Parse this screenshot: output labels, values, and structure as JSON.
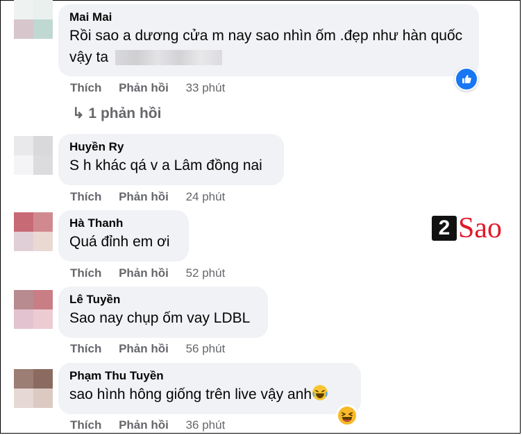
{
  "actions": {
    "like": "Thích",
    "reply": "Phản hồi"
  },
  "comments": [
    {
      "name": "Mai Mai",
      "text": "Rồi sao a dương cửa m nay sao nhìn ốm .đẹp như hàn quốc vậy ta",
      "time": "33 phút",
      "reaction": "like-icon"
    },
    {
      "name": "Huyền Ry",
      "text": "S h khác qá v a Lâm đồng nai",
      "time": "24 phút"
    },
    {
      "name": "Hà Thanh",
      "text": "Quá đỉnh em ơi",
      "time": "52 phút"
    },
    {
      "name": "Lê Tuyền",
      "text": "Sao nay chụp ốm vay LDBL",
      "time": "56 phút"
    },
    {
      "name": "Phạm Thu Tuyền",
      "text": "sao hình hông giống trên live vậy anh",
      "time": "36 phút",
      "reaction": "haha-icon"
    }
  ],
  "replies_label": "↳ 1 phản hồi",
  "watermark": {
    "number": "2",
    "word": "Sao"
  },
  "colors": {
    "bubble": "#f0f2f5",
    "secondary_text": "#65676b",
    "like_blue": "#1877f2",
    "logo_red": "#e0192b"
  }
}
